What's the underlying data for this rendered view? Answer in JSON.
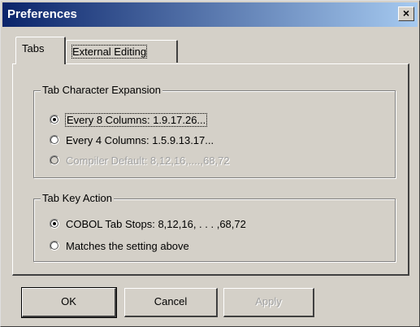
{
  "window": {
    "title": "Preferences",
    "close_glyph": "×",
    "close_icon": "close-icon"
  },
  "tabs": [
    {
      "label": "Tabs",
      "active": true
    },
    {
      "label": "External Editing",
      "active": false
    }
  ],
  "tab_character_expansion": {
    "legend": "Tab Character Expansion",
    "options": [
      {
        "label": "Every 8 Columns: 1.9.17.26...",
        "checked": true,
        "enabled": true
      },
      {
        "label": "Every 4 Columns: 1.5.9.13.17...",
        "checked": false,
        "enabled": true
      },
      {
        "label": "Compiler Default: 8,12,16,....,68,72",
        "checked": false,
        "enabled": false
      }
    ]
  },
  "tab_key_action": {
    "legend": "Tab Key Action",
    "options": [
      {
        "label": "COBOL Tab Stops: 8,12,16, . . . ,68,72",
        "checked": true,
        "enabled": true
      },
      {
        "label": "Matches the setting above",
        "checked": false,
        "enabled": true
      }
    ]
  },
  "buttons": {
    "ok": "OK",
    "cancel": "Cancel",
    "apply": "Apply"
  }
}
